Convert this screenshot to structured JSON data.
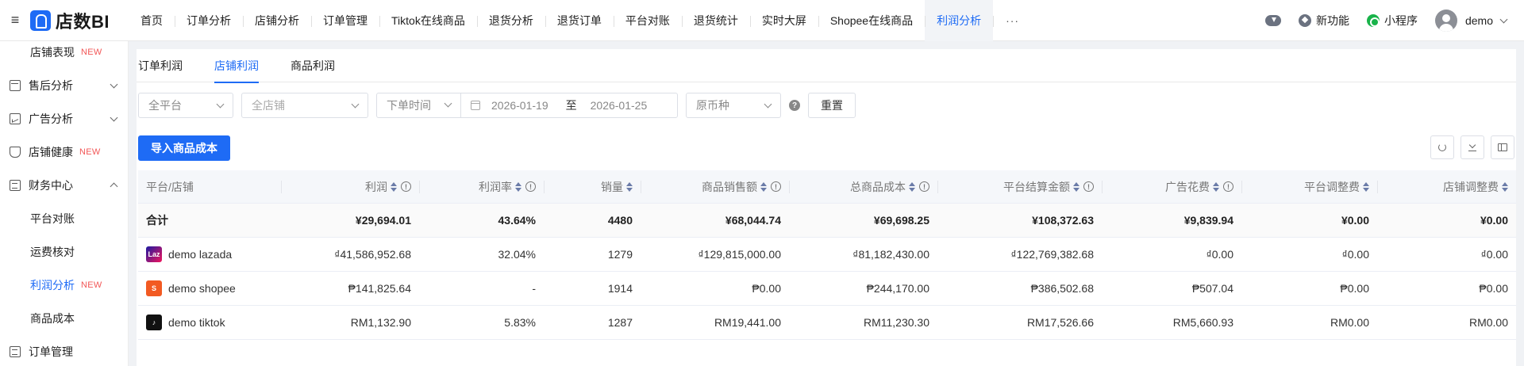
{
  "app": {
    "brand": "店数BI"
  },
  "nav": {
    "items": [
      "首页",
      "订单分析",
      "店铺分析",
      "订单管理",
      "Tiktok在线商品",
      "退货分析",
      "退货订单",
      "平台对账",
      "退货统计",
      "实时大屏",
      "Shopee在线商品",
      "利润分析"
    ],
    "active_index": 11,
    "more": "···"
  },
  "header_right": {
    "new_feature": "新功能",
    "mini_program": "小程序",
    "user": "demo"
  },
  "sidebar": {
    "items": [
      {
        "label": "店铺表现",
        "badge": "NEW",
        "level": "sub"
      },
      {
        "label": "售后分析",
        "level": "top",
        "expanded": false
      },
      {
        "label": "广告分析",
        "level": "top",
        "expanded": false
      },
      {
        "label": "店铺健康",
        "badge": "NEW",
        "level": "top"
      },
      {
        "label": "财务中心",
        "level": "top",
        "expanded": true
      },
      {
        "label": "平台对账",
        "level": "sub"
      },
      {
        "label": "运费核对",
        "level": "sub"
      },
      {
        "label": "利润分析",
        "badge": "NEW",
        "level": "sub",
        "active": true
      },
      {
        "label": "商品成本",
        "level": "sub"
      },
      {
        "label": "订单管理",
        "level": "top"
      }
    ]
  },
  "tabs": {
    "items": [
      "订单利润",
      "店铺利润",
      "商品利润"
    ],
    "active_index": 1
  },
  "filters": {
    "platform": "全平台",
    "shop": "全店铺",
    "time_type": "下单时间",
    "date_from": "2026-01-19",
    "date_sep": "至",
    "date_to": "2026-01-25",
    "currency": "原币种",
    "help": "?",
    "reset": "重置"
  },
  "actions": {
    "import_cost": "导入商品成本"
  },
  "table": {
    "columns": [
      {
        "label": "平台/店铺",
        "sort": false,
        "info": false
      },
      {
        "label": "利润",
        "sort": true,
        "info": true
      },
      {
        "label": "利润率",
        "sort": true,
        "info": true
      },
      {
        "label": "销量",
        "sort": true,
        "info": false
      },
      {
        "label": "商品销售额",
        "sort": true,
        "info": true
      },
      {
        "label": "总商品成本",
        "sort": true,
        "info": true
      },
      {
        "label": "平台结算金额",
        "sort": true,
        "info": true
      },
      {
        "label": "广告花费",
        "sort": true,
        "info": true
      },
      {
        "label": "平台调整费",
        "sort": true,
        "info": false
      },
      {
        "label": "店铺调整费",
        "sort": true,
        "info": false
      }
    ],
    "total": [
      "合计",
      "¥29,694.01",
      "43.64%",
      "4480",
      "¥68,044.74",
      "¥69,698.25",
      "¥108,372.63",
      "¥9,839.94",
      "¥0.00",
      "¥0.00"
    ],
    "rows": [
      {
        "logo": "lazada",
        "logo_text": "Laz",
        "cells": [
          "demo lazada",
          "₫41,586,952.68",
          "32.04%",
          "1279",
          "₫129,815,000.00",
          "₫81,182,430.00",
          "₫122,769,382.68",
          "₫0.00",
          "₫0.00",
          "₫0.00"
        ]
      },
      {
        "logo": "shopee",
        "logo_text": "S",
        "cells": [
          "demo shopee",
          "₱141,825.64",
          "-",
          "1914",
          "₱0.00",
          "₱244,170.00",
          "₱386,502.68",
          "₱507.04",
          "₱0.00",
          "₱0.00"
        ]
      },
      {
        "logo": "tiktok",
        "logo_text": "♪",
        "cells": [
          "demo tiktok",
          "RM1,132.90",
          "5.83%",
          "1287",
          "RM19,441.00",
          "RM11,230.30",
          "RM17,526.66",
          "RM5,660.93",
          "RM0.00",
          "RM0.00"
        ]
      }
    ]
  }
}
